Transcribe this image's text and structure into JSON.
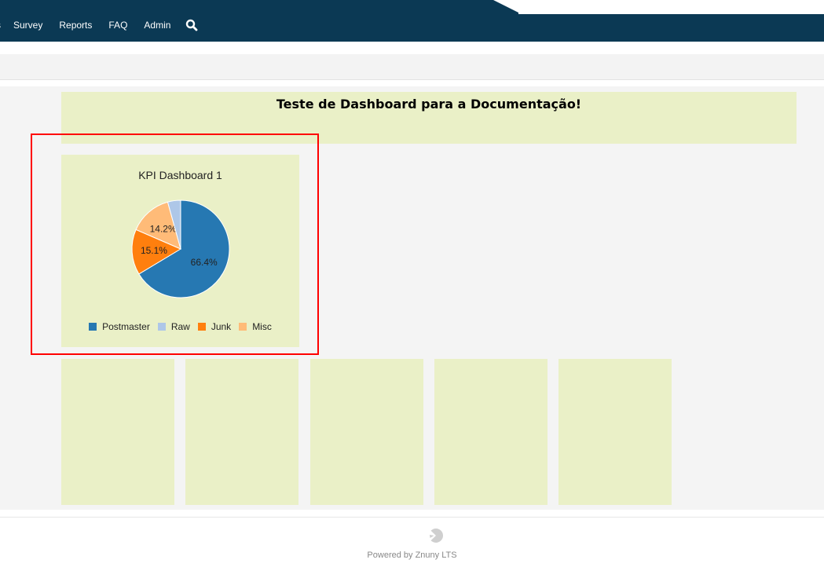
{
  "nav": {
    "items": [
      {
        "label": "s",
        "partial": true
      },
      {
        "label": "Survey"
      },
      {
        "label": "Reports"
      },
      {
        "label": "FAQ"
      },
      {
        "label": "Admin"
      }
    ],
    "search_icon": "search-icon"
  },
  "dashboard": {
    "header_title": "Teste de Dashboard para a Documentação!",
    "kpi_widget": {
      "title": "KPI Dashboard 1"
    },
    "empty_widgets_count": 5
  },
  "chart_data": {
    "type": "pie",
    "title": "KPI Dashboard 1",
    "categories": [
      "Postmaster",
      "Raw",
      "Junk",
      "Misc"
    ],
    "values": [
      66.4,
      4.3,
      15.1,
      14.2
    ],
    "labels": [
      "66.4%",
      "",
      "15.1%",
      "14.2%"
    ],
    "colors": [
      "#2678b2",
      "#aec7e8",
      "#ff7f0e",
      "#ffbb78"
    ],
    "legend": [
      "Postmaster",
      "Raw",
      "Junk",
      "Misc"
    ],
    "legend_position": "bottom",
    "slice_order": [
      "Postmaster",
      "Junk",
      "Misc",
      "Raw"
    ]
  },
  "footer": {
    "text": "Powered by Znuny LTS",
    "logo_icon": "znuny-logo-icon"
  },
  "colors": {
    "topbar": "#0b3954",
    "widget_bg": "#eaf0c7",
    "content_bg": "#f4f4f4",
    "highlight": "#ff0000"
  }
}
